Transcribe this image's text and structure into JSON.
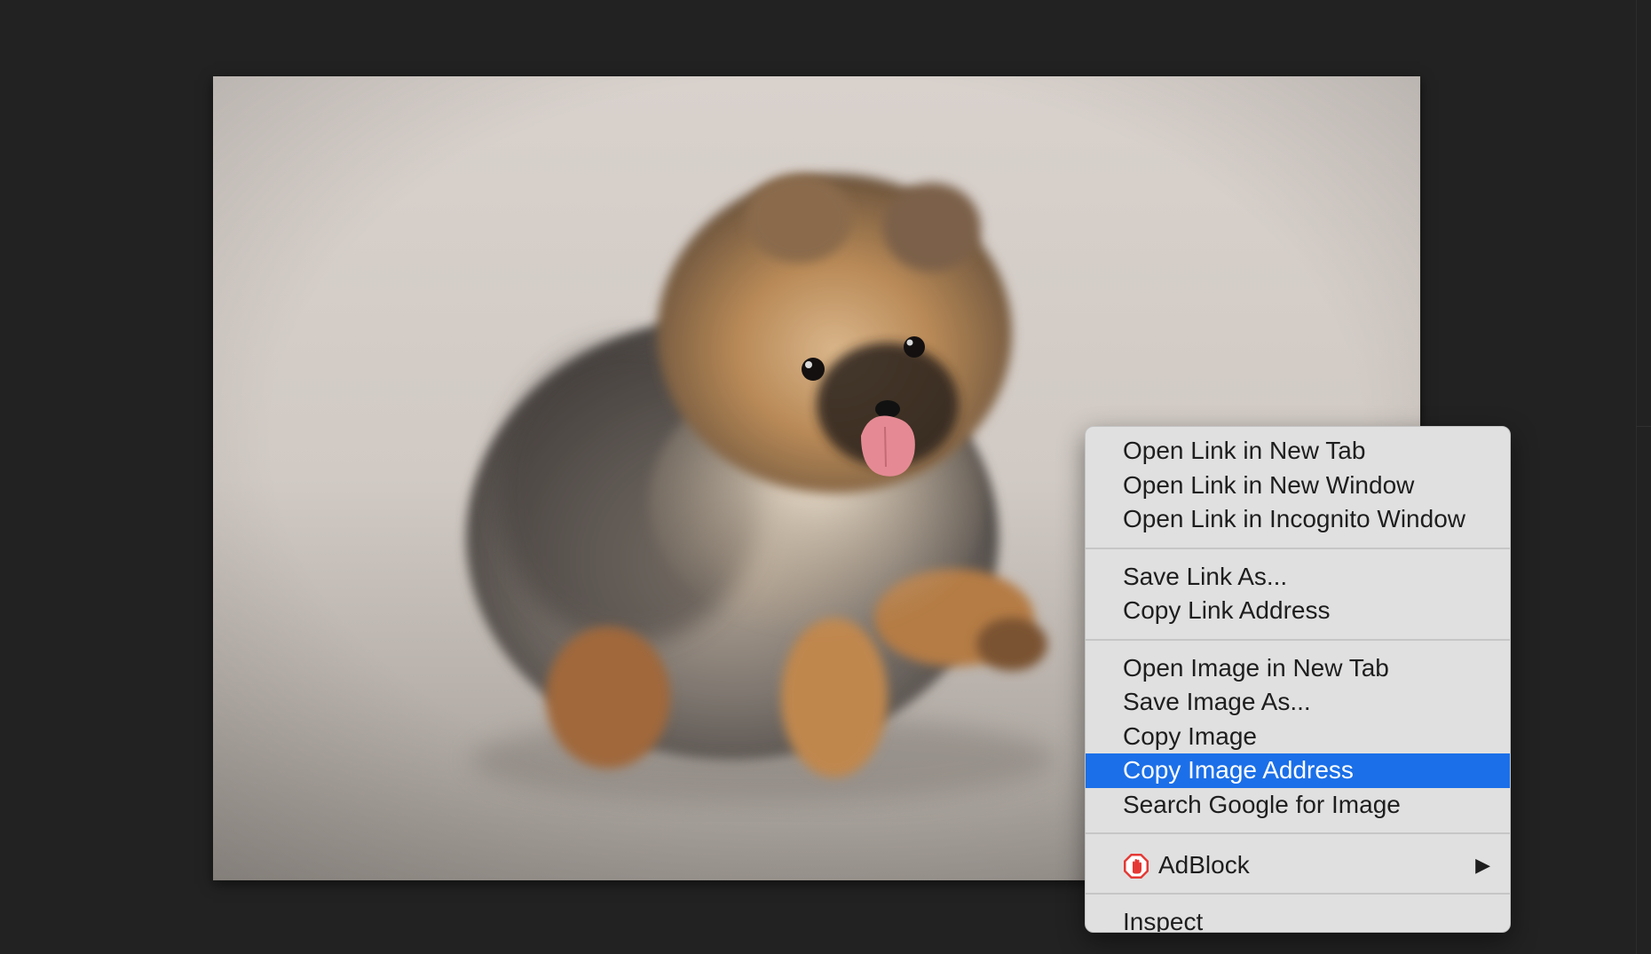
{
  "context_menu": {
    "groups": [
      {
        "items": [
          {
            "label": "Open Link in New Tab"
          },
          {
            "label": "Open Link in New Window"
          },
          {
            "label": "Open Link in Incognito Window"
          }
        ]
      },
      {
        "items": [
          {
            "label": "Save Link As..."
          },
          {
            "label": "Copy Link Address"
          }
        ]
      },
      {
        "items": [
          {
            "label": "Open Image in New Tab"
          },
          {
            "label": "Save Image As..."
          },
          {
            "label": "Copy Image"
          },
          {
            "label": "Copy Image Address",
            "highlighted": true
          },
          {
            "label": "Search Google for Image"
          }
        ]
      },
      {
        "items": [
          {
            "label": "AdBlock",
            "icon": "adblock-hand-icon",
            "submenu_arrow": "▶"
          }
        ]
      },
      {
        "items": [
          {
            "label": "Inspect"
          }
        ]
      }
    ],
    "highlight_color": "#1b6fe8"
  },
  "photo": {
    "subject_icon": "pomeranian-puppy-image"
  },
  "colors": {
    "page_background": "#222222",
    "menu_background": "#e0e0e0"
  }
}
